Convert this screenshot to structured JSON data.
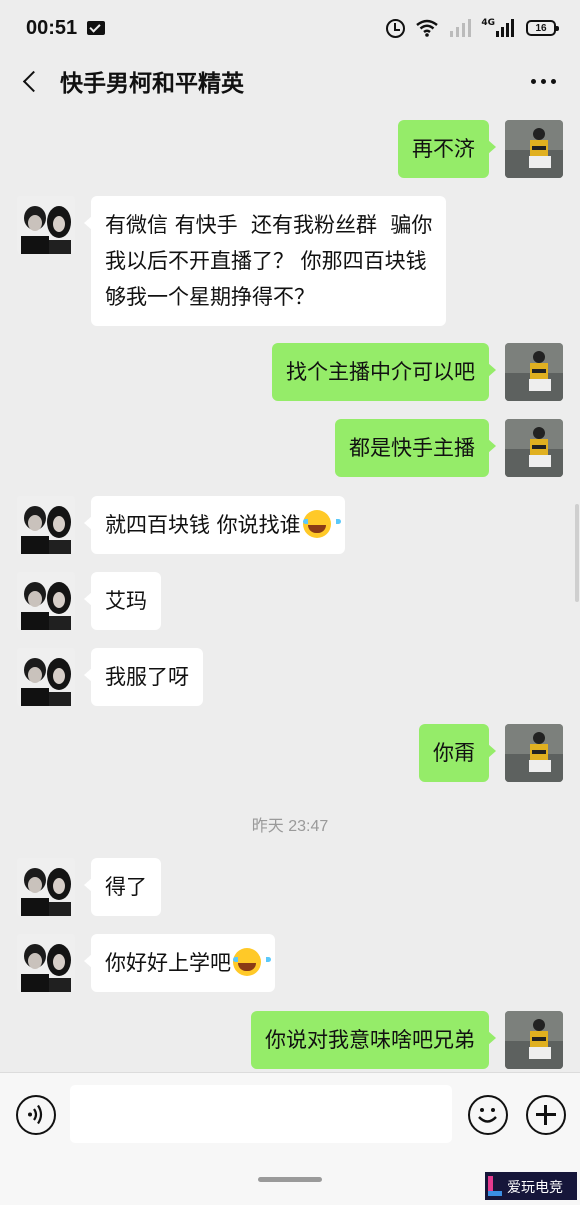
{
  "status_bar": {
    "time": "00:51",
    "network": "4G",
    "battery": "16"
  },
  "header": {
    "title": "快手男柯和平精英"
  },
  "messages": [
    {
      "side": "right",
      "text": "再不济"
    },
    {
      "side": "left",
      "text": "有微信 有快手  还有我粉丝群  骗你\n我以后不开直播了？ 你那四百块钱\n够我一个星期挣得不？"
    },
    {
      "side": "right",
      "text": "找个主播中介可以吧"
    },
    {
      "side": "right",
      "text": "都是快手主播"
    },
    {
      "side": "left",
      "text": "就四百块钱 你说找谁",
      "emoji": "laugh-cry-emoji"
    },
    {
      "side": "left",
      "text": "艾玛"
    },
    {
      "side": "left",
      "text": "我服了呀"
    },
    {
      "side": "right",
      "text": "你甭"
    },
    {
      "side": "left",
      "text": "得了"
    },
    {
      "side": "left",
      "text": "你好好上学吧",
      "emoji": "laugh-cry-emoji"
    },
    {
      "side": "right",
      "text": "你说对我意味啥吧兄弟"
    }
  ],
  "timestamp": "昨天 23:47",
  "input": {
    "value": "",
    "placeholder": ""
  },
  "colors": {
    "background": "#ededed",
    "outgoing_bubble": "#95ec69",
    "incoming_bubble": "#ffffff",
    "input_bar": "#f7f7f7"
  },
  "watermark": {
    "text": "爱玩电竞"
  }
}
